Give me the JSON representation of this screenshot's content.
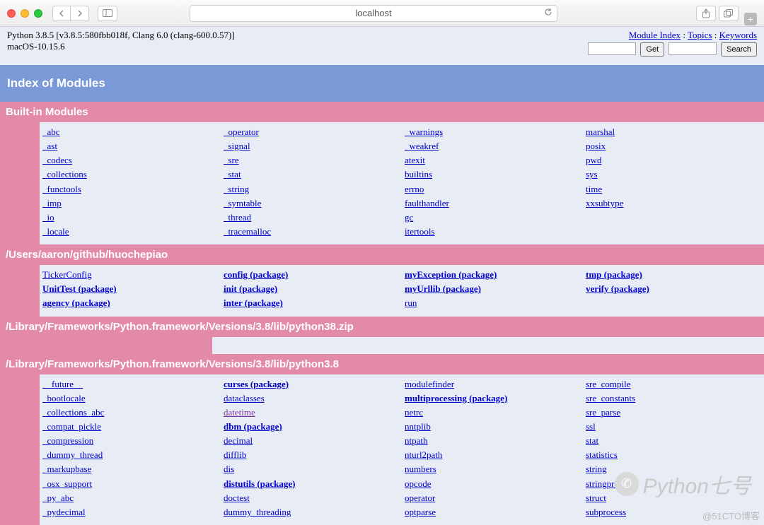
{
  "browser": {
    "address": "localhost"
  },
  "header": {
    "version_line": "Python 3.8.5 [v3.8.5:580fbb018f, Clang 6.0 (clang-600.0.57)]",
    "os_line": "macOS-10.15.6",
    "links": {
      "module_index": "Module Index",
      "topics": "Topics",
      "keywords": "Keywords"
    },
    "get_label": "Get",
    "search_label": "Search"
  },
  "banner": {
    "title": "Index of Modules"
  },
  "sections": [
    {
      "title": "Built-in Modules",
      "columns": [
        [
          {
            "t": "_abc"
          },
          {
            "t": "_ast"
          },
          {
            "t": "_codecs"
          },
          {
            "t": "_collections"
          },
          {
            "t": "_functools"
          },
          {
            "t": "_imp"
          },
          {
            "t": "_io"
          },
          {
            "t": "_locale"
          }
        ],
        [
          {
            "t": "_operator"
          },
          {
            "t": "_signal"
          },
          {
            "t": "_sre"
          },
          {
            "t": "_stat"
          },
          {
            "t": "_string"
          },
          {
            "t": "_symtable"
          },
          {
            "t": "_thread"
          },
          {
            "t": "_tracemalloc"
          }
        ],
        [
          {
            "t": "_warnings"
          },
          {
            "t": "_weakref"
          },
          {
            "t": "atexit"
          },
          {
            "t": "builtins"
          },
          {
            "t": "errno"
          },
          {
            "t": "faulthandler"
          },
          {
            "t": "gc"
          },
          {
            "t": "itertools"
          }
        ],
        [
          {
            "t": "marshal"
          },
          {
            "t": "posix"
          },
          {
            "t": "pwd"
          },
          {
            "t": "sys"
          },
          {
            "t": "time"
          },
          {
            "t": "xxsubtype"
          }
        ]
      ]
    },
    {
      "title": "/Users/aaron/github/huochepiao",
      "columns": [
        [
          {
            "t": "TickerConfig"
          },
          {
            "t": "UnitTest (package)",
            "b": true
          },
          {
            "t": "agency (package)",
            "b": true
          }
        ],
        [
          {
            "t": "config (package)",
            "b": true
          },
          {
            "t": "init (package)",
            "b": true
          },
          {
            "t": "inter (package)",
            "b": true
          }
        ],
        [
          {
            "t": "myException (package)",
            "b": true
          },
          {
            "t": "myUrllib (package)",
            "b": true
          },
          {
            "t": "run"
          }
        ],
        [
          {
            "t": "tmp (package)",
            "b": true
          },
          {
            "t": "verify (package)",
            "b": true
          }
        ]
      ]
    },
    {
      "title": "/Library/Frameworks/Python.framework/Versions/3.8/lib/python38.zip",
      "empty": true
    },
    {
      "title": "/Library/Frameworks/Python.framework/Versions/3.8/lib/python3.8",
      "columns": [
        [
          {
            "t": "__future__"
          },
          {
            "t": "_bootlocale"
          },
          {
            "t": "_collections_abc"
          },
          {
            "t": "_compat_pickle"
          },
          {
            "t": "_compression"
          },
          {
            "t": "_dummy_thread"
          },
          {
            "t": "_markupbase"
          },
          {
            "t": "_osx_support"
          },
          {
            "t": "_py_abc"
          },
          {
            "t": "_pydecimal"
          }
        ],
        [
          {
            "t": "curses (package)",
            "b": true
          },
          {
            "t": "dataclasses"
          },
          {
            "t": "datetime",
            "v": true
          },
          {
            "t": "dbm (package)",
            "b": true
          },
          {
            "t": "decimal"
          },
          {
            "t": "difflib"
          },
          {
            "t": "dis"
          },
          {
            "t": "distutils (package)",
            "b": true
          },
          {
            "t": "doctest"
          },
          {
            "t": "dummy_threading"
          }
        ],
        [
          {
            "t": "modulefinder"
          },
          {
            "t": "multiprocessing (package)",
            "b": true
          },
          {
            "t": "netrc"
          },
          {
            "t": "nntplib"
          },
          {
            "t": "ntpath"
          },
          {
            "t": "nturl2path"
          },
          {
            "t": "numbers"
          },
          {
            "t": "opcode"
          },
          {
            "t": "operator"
          },
          {
            "t": "optparse"
          }
        ],
        [
          {
            "t": "sre_compile"
          },
          {
            "t": "sre_constants"
          },
          {
            "t": "sre_parse"
          },
          {
            "t": "ssl"
          },
          {
            "t": "stat"
          },
          {
            "t": "statistics"
          },
          {
            "t": "string"
          },
          {
            "t": "stringprep"
          },
          {
            "t": "struct"
          },
          {
            "t": "subprocess"
          }
        ]
      ]
    }
  ],
  "watermark": {
    "text": "Python七号",
    "attrib": "@51CTO博客"
  }
}
